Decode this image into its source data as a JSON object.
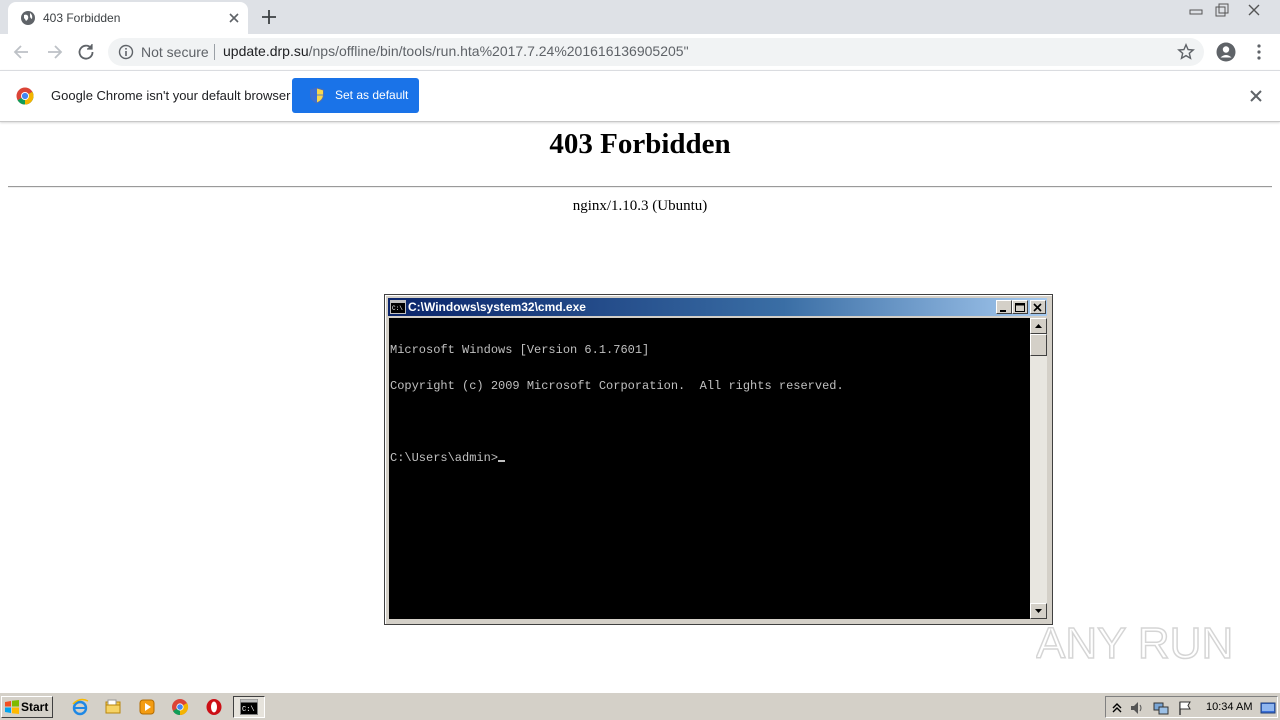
{
  "browser": {
    "tab": {
      "title": "403 Forbidden"
    },
    "omnibox": {
      "security_label": "Not secure",
      "url_host": "update.drp.su",
      "url_path": "/nps/offline/bin/tools/run.hta%2017.7.24%201616136905205\""
    },
    "infobar": {
      "message": "Google Chrome isn't your default browser",
      "button_label": "Set as default"
    }
  },
  "page": {
    "heading": "403 Forbidden",
    "server": "nginx/1.10.3 (Ubuntu)"
  },
  "cmd": {
    "title": "C:\\Windows\\system32\\cmd.exe",
    "lines": [
      "Microsoft Windows [Version 6.1.7601]",
      "Copyright (c) 2009 Microsoft Corporation.  All rights reserved.",
      "",
      "C:\\Users\\admin>"
    ]
  },
  "watermark": {
    "text": "ANY RUN"
  },
  "taskbar": {
    "start_label": "Start",
    "clock": "10:34 AM",
    "pinned": [
      "ie-icon",
      "explorer-icon",
      "media-player-icon",
      "chrome-icon",
      "opera-icon"
    ],
    "active_task": "cmd-icon"
  },
  "colors": {
    "chrome_titlebar": "#dee1e6",
    "infobar_button": "#1a73e8",
    "cmd_title_start": "#0a246a",
    "cmd_title_end": "#a6caf0",
    "taskbar": "#d4d0c8"
  }
}
